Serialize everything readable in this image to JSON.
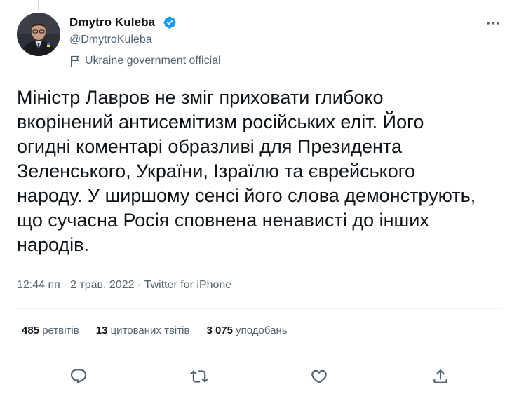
{
  "author": {
    "name": "Dmytro Kuleba",
    "handle": "@DmytroKuleba",
    "label": "Ukraine government official"
  },
  "tweet": {
    "text": "Міністр Лавров не зміг приховати глибоко\nвкорінений антисемітизм російських еліт. Його\nогидні коментарі образливі для Президента\nЗеленського, України, Ізраїлю та єврейського\nнароду. У ширшому сенсі його слова демонструють,\nщо сучасна Росія сповнена ненависті до інших\nнародів.",
    "meta": "12:44 пп · 2 трав. 2022 · Twitter for iPhone"
  },
  "stats": {
    "retweets_count": "485",
    "retweets_label": "ретвітів",
    "quotes_count": "13",
    "quotes_label": "цитованих твітів",
    "likes_count": "3 075",
    "likes_label": "уподобань"
  },
  "icons": {
    "verified": "verified-badge-icon",
    "more": "more-icon",
    "flag": "government-flag-icon",
    "reply": "reply-icon",
    "retweet": "retweet-icon",
    "like": "like-icon",
    "share": "share-icon"
  },
  "colors": {
    "verified": "#1d9bf0",
    "muted": "#536471",
    "text": "#0f1419"
  }
}
